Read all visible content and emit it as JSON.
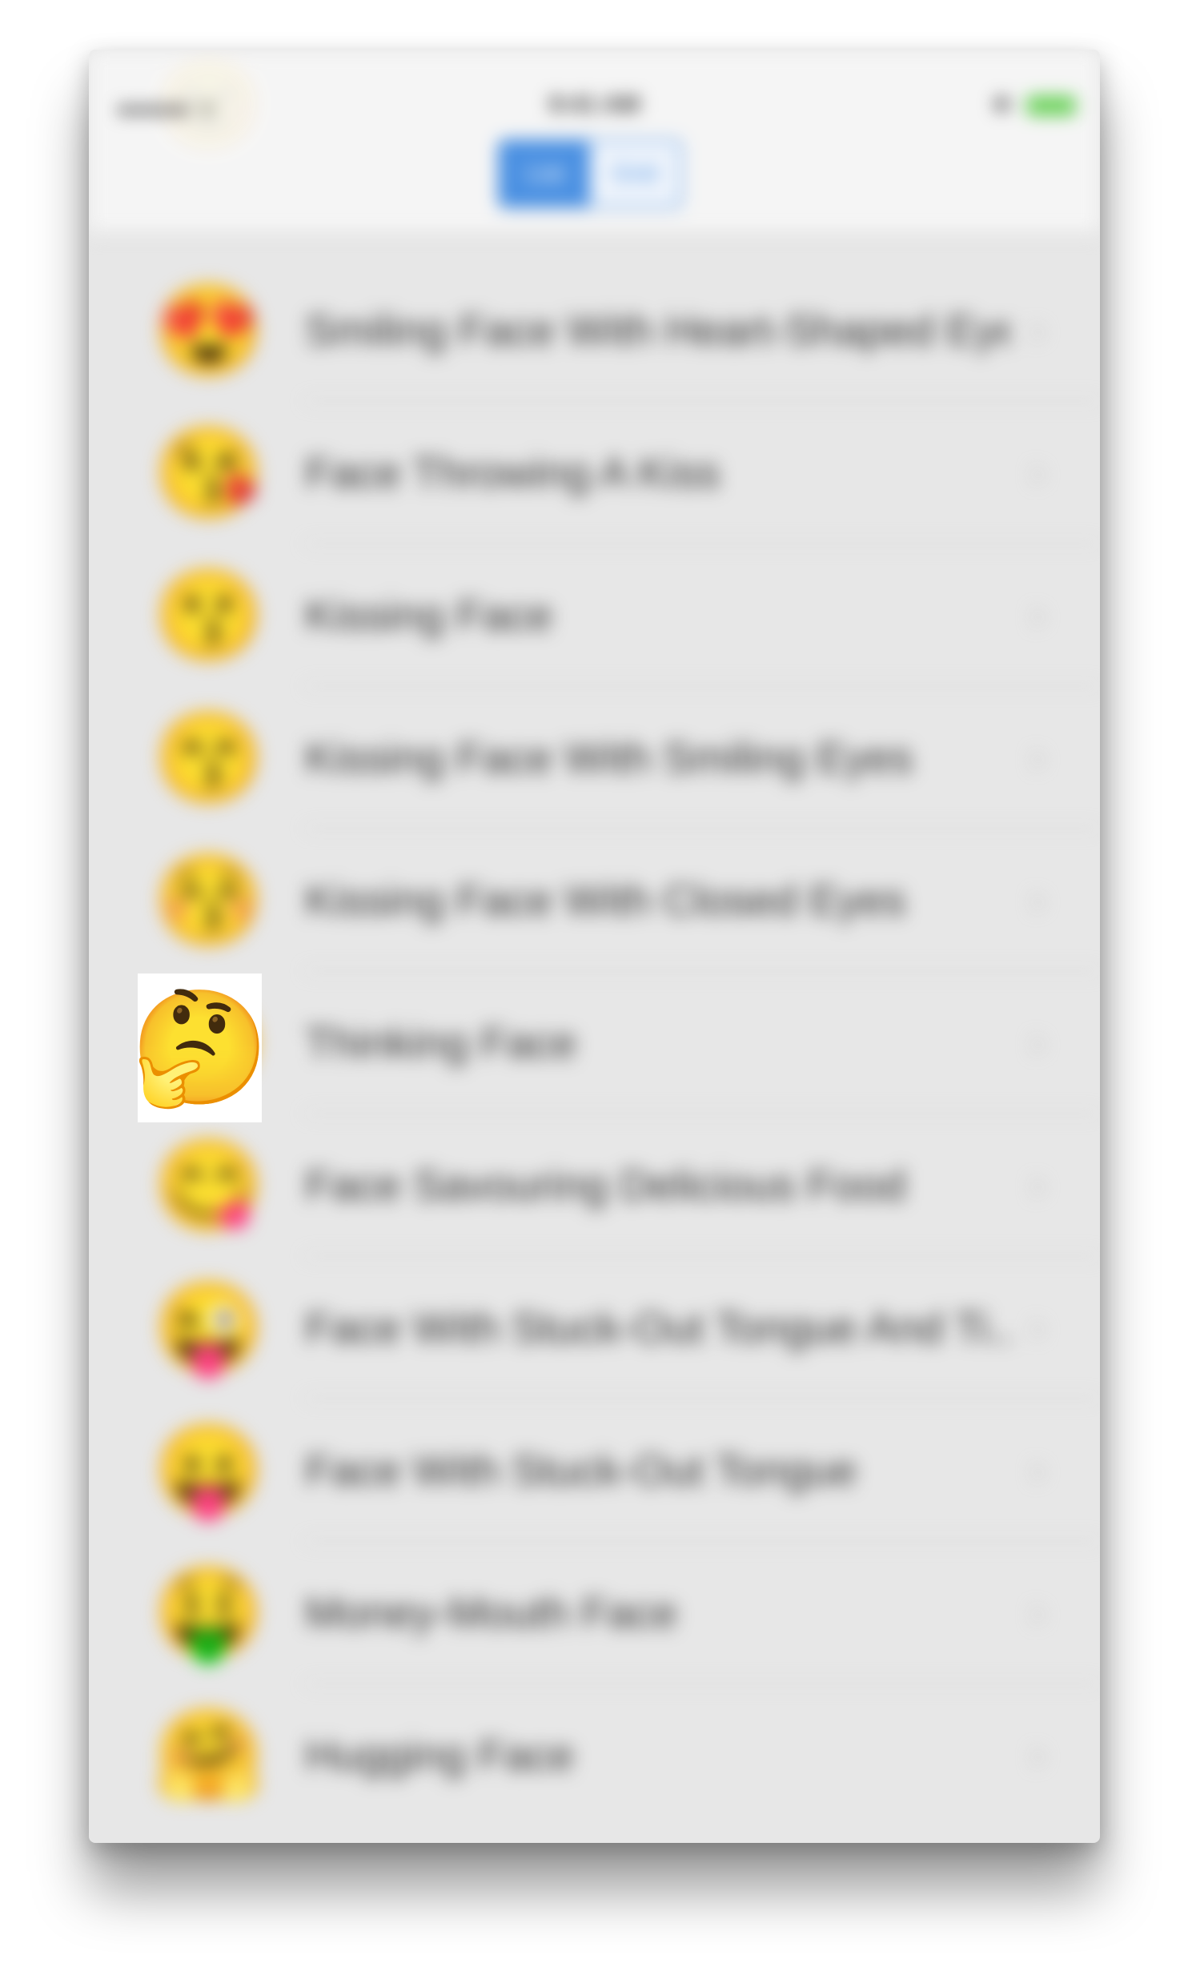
{
  "status_bar": {
    "carrier": "●●●●● ᯤ",
    "time": "9:41 AM",
    "bluetooth_icon": "bluetooth-icon"
  },
  "nav_bar": {
    "segments": [
      "List",
      "Grid"
    ],
    "selected_segment": "List"
  },
  "list": {
    "rows": [
      {
        "emoji": "😍",
        "label": "Smiling Face With Heart-Shaped Eyes"
      },
      {
        "emoji": "😘",
        "label": "Face Throwing A Kiss"
      },
      {
        "emoji": "😗",
        "label": "Kissing Face"
      },
      {
        "emoji": "😙",
        "label": "Kissing Face With Smiling Eyes"
      },
      {
        "emoji": "😚",
        "label": "Kissing Face With Closed Eyes"
      },
      {
        "emoji": "🤔",
        "label": "Thinking Face"
      },
      {
        "emoji": "😋",
        "label": "Face Savouring Delicious Food"
      },
      {
        "emoji": "😜",
        "label": "Face With Stuck-Out Tongue And Ti..."
      },
      {
        "emoji": "😛",
        "label": "Face With Stuck-Out Tongue"
      },
      {
        "emoji": "🤑",
        "label": "Money-Mouth Face"
      },
      {
        "emoji": "🤗",
        "label": "Hugging Face"
      }
    ],
    "chevron": "›"
  },
  "focus": {
    "emoji": "🤔"
  },
  "colors": {
    "accent": "#4a90e2",
    "battery": "#6bd35a",
    "list_background": "#e7e7e7"
  }
}
